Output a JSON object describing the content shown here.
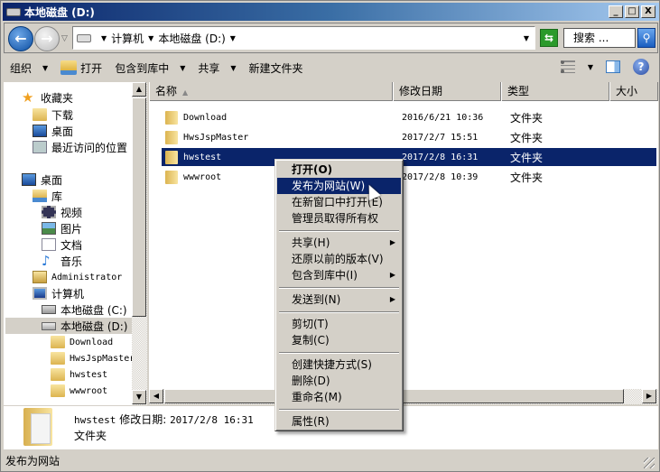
{
  "window": {
    "title": "本地磁盘 (D:)",
    "minimize": "_",
    "maximize": "□",
    "close": "X"
  },
  "address": {
    "crumbs": [
      "计算机",
      "本地磁盘 (D:)"
    ],
    "search_placeholder": "搜索 ..."
  },
  "toolbar": {
    "organize": "组织",
    "open": "打开",
    "include_library": "包含到库中",
    "share": "共享",
    "new_folder": "新建文件夹"
  },
  "nav": {
    "favorites": "收藏夹",
    "downloads": "下载",
    "desktop_fav": "桌面",
    "recent": "最近访问的位置",
    "desktop": "桌面",
    "libraries": "库",
    "videos": "视频",
    "pictures": "图片",
    "documents": "文档",
    "music": "音乐",
    "admin": "Administrator",
    "computer": "计算机",
    "drive_c": "本地磁盘 (C:)",
    "drive_d": "本地磁盘 (D:)",
    "folders": [
      "Download",
      "HwsJspMaster",
      "hwstest",
      "wwwroot"
    ]
  },
  "columns": {
    "name": "名称",
    "date": "修改日期",
    "type": "类型",
    "size": "大小"
  },
  "files": [
    {
      "name": "Download",
      "date": "2016/6/21 10:36",
      "type": "文件夹"
    },
    {
      "name": "HwsJspMaster",
      "date": "2017/2/7 15:51",
      "type": "文件夹"
    },
    {
      "name": "hwstest",
      "date": "2017/2/8 16:31",
      "type": "文件夹"
    },
    {
      "name": "wwwroot",
      "date": "2017/2/8 10:39",
      "type": "文件夹"
    }
  ],
  "context_menu": {
    "open": "打开(O)",
    "publish": "发布为网站(W)",
    "open_new_window": "在新窗口中打开(E)",
    "take_ownership": "管理员取得所有权",
    "share": "共享(H)",
    "restore": "还原以前的版本(V)",
    "include_library": "包含到库中(I)",
    "send_to": "发送到(N)",
    "cut": "剪切(T)",
    "copy": "复制(C)",
    "create_shortcut": "创建快捷方式(S)",
    "delete": "删除(D)",
    "rename": "重命名(M)",
    "properties": "属性(R)"
  },
  "details": {
    "name": "hwstest",
    "date_label": "修改日期:",
    "date": "2017/2/8 16:31",
    "type": "文件夹"
  },
  "status": "发布为网站"
}
